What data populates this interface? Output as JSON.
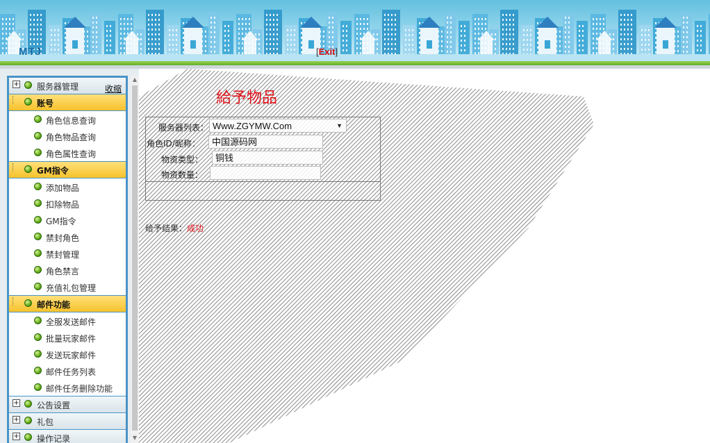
{
  "header": {
    "brand": "MTJ",
    "exit_open": "[",
    "exit_label": "Exit",
    "exit_close": "]",
    "colors": {
      "sky": "#63c0df",
      "band": "#7ac043",
      "exit": "#e01010"
    }
  },
  "sidebar": {
    "collapse_label": "收缩",
    "groups": [
      {
        "label": "服务器管理",
        "expanded": false,
        "items": []
      },
      {
        "label": "账号",
        "expanded": true,
        "items": [
          "角色信息查询",
          "角色物品查询",
          "角色属性查询"
        ]
      },
      {
        "label": "GM指令",
        "expanded": true,
        "items": [
          "添加物品",
          "扣除物品",
          "GM指令",
          "禁封角色",
          "禁封管理",
          "角色禁言",
          "充值礼包管理"
        ]
      },
      {
        "label": "邮件功能",
        "expanded": true,
        "items": [
          "全服发送邮件",
          "批量玩家邮件",
          "发送玩家邮件",
          "邮件任务列表",
          "邮件任务删除功能"
        ]
      },
      {
        "label": "公告设置",
        "expanded": false,
        "items": []
      },
      {
        "label": "礼包",
        "expanded": false,
        "items": []
      },
      {
        "label": "操作记录",
        "expanded": false,
        "items": []
      }
    ]
  },
  "main": {
    "title": "給予物品",
    "form": {
      "server_label": "服务器列表：",
      "server_value": "Www.ZGYMW.Com",
      "role_label": "角色ID/昵称：",
      "role_value": "中国源码网",
      "type_label": "物资类型：",
      "type_value": "铜钱",
      "qty_label": "物资数量：",
      "qty_value": ""
    },
    "result_label": "给予结果：",
    "result_value": "成功",
    "colors": {
      "title": "#e0141c",
      "result": "#e0141c"
    }
  }
}
